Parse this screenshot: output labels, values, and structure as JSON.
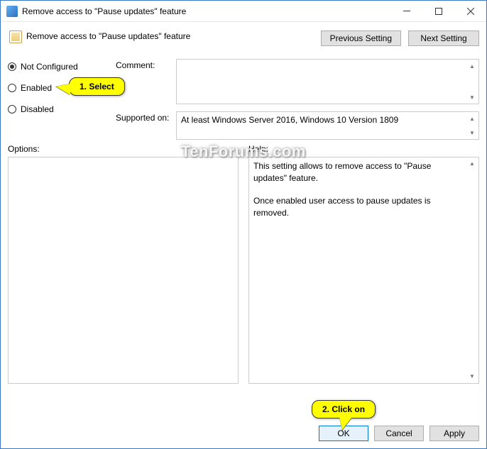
{
  "titlebar": {
    "title": "Remove access to \"Pause updates\" feature"
  },
  "header": {
    "policy_title": "Remove access to \"Pause updates\" feature",
    "previous_label": "Previous Setting",
    "next_label": "Next Setting"
  },
  "radios": {
    "not_configured": "Not Configured",
    "enabled": "Enabled",
    "disabled": "Disabled",
    "selected": "not_configured"
  },
  "fields": {
    "comment_label": "Comment:",
    "supported_label": "Supported on:",
    "supported_text": "At least Windows Server 2016, Windows 10 Version 1809"
  },
  "lower": {
    "options_label": "Options:",
    "help_label": "Help:",
    "help_p1": "This setting allows to remove access to \"Pause updates\" feature.",
    "help_p2": "Once enabled user access to pause updates is removed."
  },
  "footer": {
    "ok": "OK",
    "cancel": "Cancel",
    "apply": "Apply"
  },
  "callouts": {
    "select": "1. Select",
    "click": "2. Click on"
  },
  "watermark": "TenForums.com"
}
